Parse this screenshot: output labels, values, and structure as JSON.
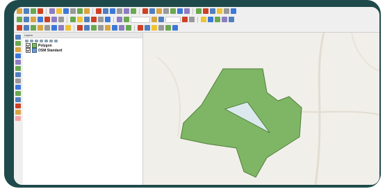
{
  "window": {
    "frame_color": "#1f4a4b"
  },
  "toolbar": {
    "icon_colors": [
      "#d9a441",
      "#4f7fbf",
      "#6aa84f",
      "#cc4125",
      "#8e7cc3",
      "#f1c232",
      "#3c78d8",
      "#999999"
    ]
  },
  "layers_panel": {
    "title": "Layers",
    "items": [
      {
        "label": "Polygon",
        "checked": true,
        "symbol_color": "#7eb665"
      },
      {
        "label": "OSM Standard",
        "checked": true,
        "symbol_color": "#6b9ad0"
      }
    ]
  },
  "map": {
    "background_color": "#f1efe9",
    "polygon_fill": "#7eb665",
    "polygon_stroke": "#4f7f3a",
    "hole_fill": "#dbe9ee"
  }
}
